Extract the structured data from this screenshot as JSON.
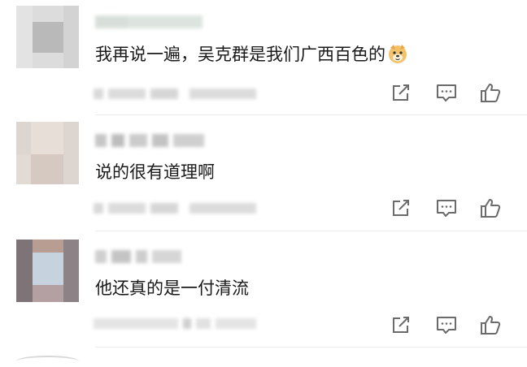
{
  "comments": [
    {
      "text": "我再说一遍，吴克群是我们广西百色的",
      "has_emoji": true,
      "emoji_name": "doge-emoji"
    },
    {
      "text": "说的很有道理啊",
      "has_emoji": false
    },
    {
      "text": "他还真的是一付清流",
      "has_emoji": false
    }
  ],
  "icons": {
    "share": "share-icon",
    "reply": "comment-icon",
    "like": "thumbs-up-icon"
  },
  "colors": {
    "text": "#1a1a1a",
    "icon": "#6b6b6b",
    "blur": "#d6d6d6"
  }
}
